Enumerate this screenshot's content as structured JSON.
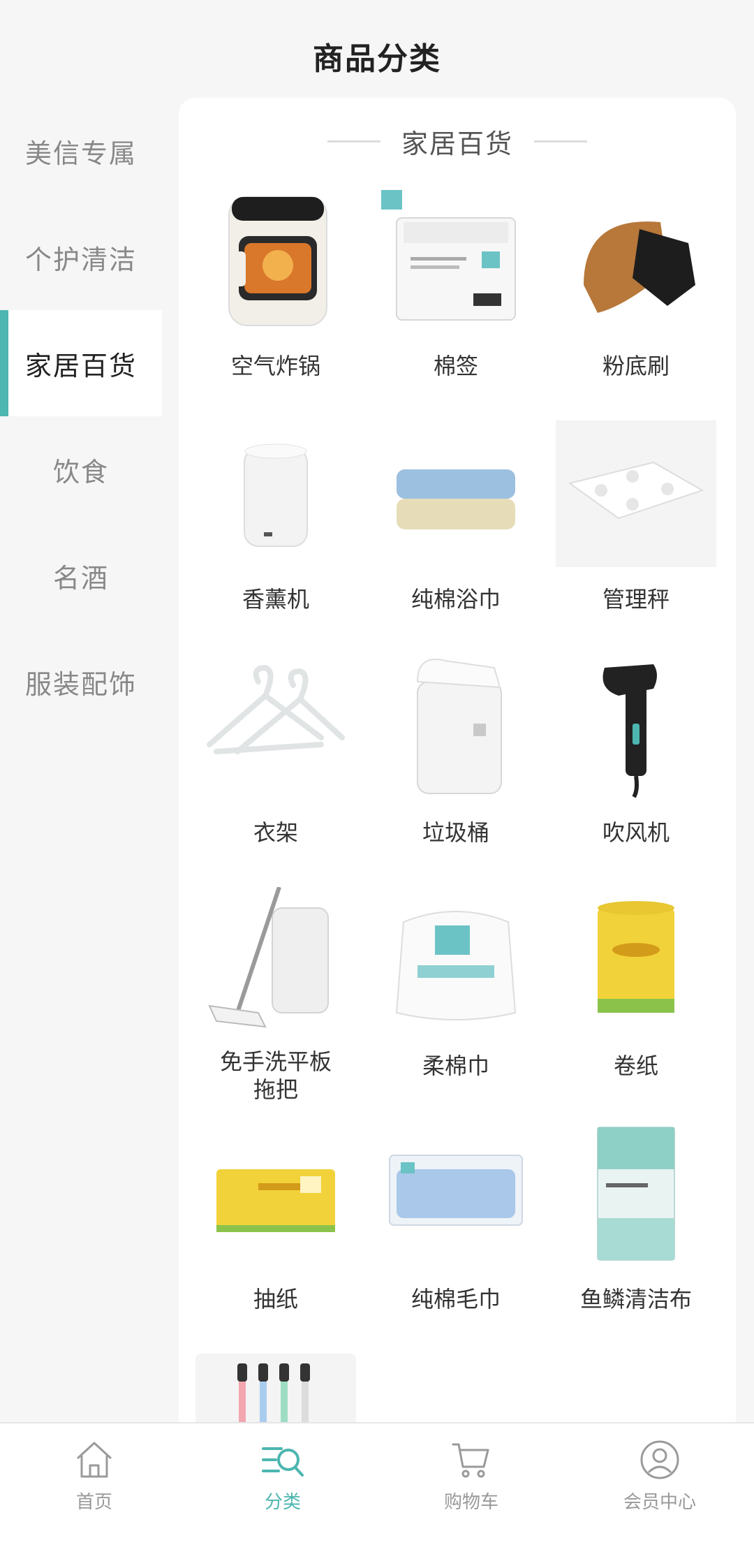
{
  "header": {
    "title": "商品分类"
  },
  "sidebar": {
    "items": [
      {
        "label": "美信专属"
      },
      {
        "label": "个护清洁"
      },
      {
        "label": "家居百货"
      },
      {
        "label": "饮食"
      },
      {
        "label": "名酒"
      },
      {
        "label": "服装配饰"
      }
    ],
    "active_index": 2
  },
  "section": {
    "title": "家居百货"
  },
  "products": [
    {
      "name": "空气炸锅",
      "icon": "air-fryer-image"
    },
    {
      "name": "棉签",
      "icon": "cotton-swab-box-image"
    },
    {
      "name": "粉底刷",
      "icon": "foundation-brush-image"
    },
    {
      "name": "香薰机",
      "icon": "aroma-diffuser-image"
    },
    {
      "name": "纯棉浴巾",
      "icon": "bath-towel-image"
    },
    {
      "name": "管理秤",
      "icon": "body-scale-image"
    },
    {
      "name": "衣架",
      "icon": "hanger-image"
    },
    {
      "name": "垃圾桶",
      "icon": "trash-bin-image"
    },
    {
      "name": "吹风机",
      "icon": "hair-dryer-image"
    },
    {
      "name": "免手洗平板\n拖把",
      "icon": "flat-mop-image"
    },
    {
      "name": "柔棉巾",
      "icon": "soft-cotton-towel-image"
    },
    {
      "name": "卷纸",
      "icon": "toilet-roll-image"
    },
    {
      "name": "抽纸",
      "icon": "tissue-box-image"
    },
    {
      "name": "纯棉毛巾",
      "icon": "towel-package-image"
    },
    {
      "name": "鱼鳞清洁布",
      "icon": "cleaning-cloth-image"
    },
    {
      "name": "",
      "icon": "toothbrush-image"
    }
  ],
  "tabbar": {
    "items": [
      {
        "label": "首页",
        "icon": "home-icon"
      },
      {
        "label": "分类",
        "icon": "category-search-icon"
      },
      {
        "label": "购物车",
        "icon": "cart-icon"
      },
      {
        "label": "会员中心",
        "icon": "user-icon"
      }
    ],
    "active_index": 1
  },
  "colors": {
    "accent": "#4db6b0",
    "background": "#f6f6f6",
    "panel": "#ffffff"
  }
}
